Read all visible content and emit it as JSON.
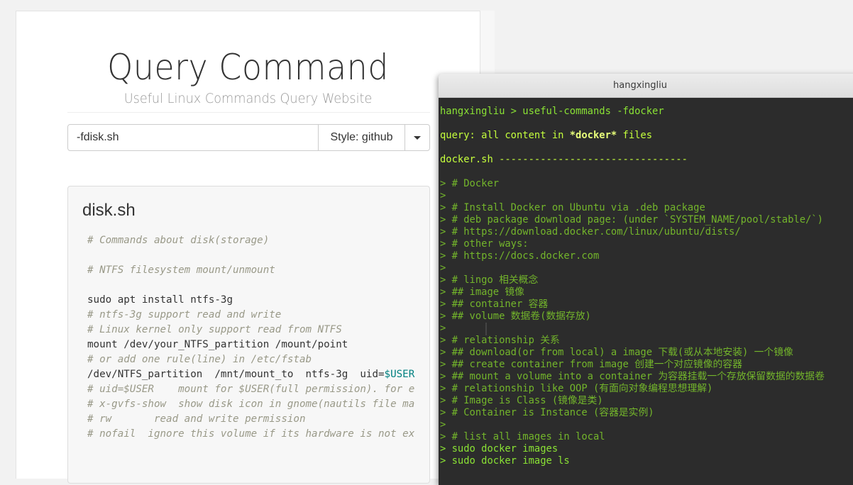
{
  "site": {
    "title": "Query Command",
    "subtitle": "Useful Linux Commands Query Website"
  },
  "search": {
    "value": "-fdisk.sh",
    "style_label": "Style: github"
  },
  "result": {
    "title": "disk.sh",
    "lines": [
      {
        "t": "# Commands about disk(storage)",
        "k": "comment"
      },
      {
        "t": "",
        "k": "code"
      },
      {
        "t": "# NTFS filesystem mount/unmount",
        "k": "comment"
      },
      {
        "t": "",
        "k": "code"
      },
      {
        "t": "sudo apt install ntfs-3g",
        "k": "code"
      },
      {
        "t": "# ntfs-3g support read and write",
        "k": "comment"
      },
      {
        "t": "# Linux kernel only support read from NTFS",
        "k": "comment"
      },
      {
        "t": "mount /dev/your_NTFS_partition /mount/point",
        "k": "code"
      },
      {
        "t": "# or add one rule(line) in /etc/fstab",
        "k": "comment"
      },
      {
        "t": "/dev/NTFS_partition  /mnt/mount_to  ntfs-3g  uid=",
        "k": "code",
        "var": "$USER"
      },
      {
        "t": "# uid=$USER    mount for $USER(full permission). for e",
        "k": "comment"
      },
      {
        "t": "# x-gvfs-show  show disk icon in gnome(nautils file ma",
        "k": "comment"
      },
      {
        "t": "# rw       read and write permission",
        "k": "comment"
      },
      {
        "t": "# nofail  ignore this volume if its hardware is not ex",
        "k": "comment"
      }
    ]
  },
  "terminal": {
    "title": "hangxingliu",
    "lines": [
      {
        "t": "hangxingliu > useful-commands -fdocker",
        "k": "prompt"
      },
      {
        "t": "",
        "k": "blank"
      },
      {
        "t": "query: all content in ",
        "k": "query",
        "bold": "*docker*",
        "rest": " files"
      },
      {
        "t": "",
        "k": "blank"
      },
      {
        "t": "docker.sh --------------------------------",
        "k": "header"
      },
      {
        "t": "",
        "k": "blank"
      },
      {
        "t": "> # Docker",
        "k": "comment"
      },
      {
        "t": ">",
        "k": "comment"
      },
      {
        "t": "> # Install Docker on Ubuntu via .deb package",
        "k": "comment"
      },
      {
        "t": "> # deb package download page: (under `SYSTEM_NAME/pool/stable/`)",
        "k": "comment"
      },
      {
        "t": "> # https://download.docker.com/linux/ubuntu/dists/",
        "k": "comment"
      },
      {
        "t": "> # other ways:",
        "k": "comment"
      },
      {
        "t": "> # https://docs.docker.com",
        "k": "comment"
      },
      {
        "t": ">",
        "k": "comment"
      },
      {
        "t": "> # lingo 相关概念",
        "k": "comment"
      },
      {
        "t": "> ## image 镜像",
        "k": "comment"
      },
      {
        "t": "> ## container 容器",
        "k": "comment"
      },
      {
        "t": "> ## volume 数据卷(数据存放)",
        "k": "comment"
      },
      {
        "t": ">",
        "k": "comment"
      },
      {
        "t": "> # relationship 关系",
        "k": "comment"
      },
      {
        "t": "> ## download(or from local) a image 下载(或从本地安装) 一个镜像",
        "k": "comment"
      },
      {
        "t": "> ## create container from image 创建一个对应镜像的容器",
        "k": "comment"
      },
      {
        "t": "> ## mount a volume into a container 为容器挂载一个存放保留数据的数据卷",
        "k": "comment"
      },
      {
        "t": "> # relationship like OOP (有面向对象编程思想理解)",
        "k": "comment"
      },
      {
        "t": "> # Image is Class (镜像是类)",
        "k": "comment"
      },
      {
        "t": "> # Container is Instance (容器是实例)",
        "k": "comment"
      },
      {
        "t": ">",
        "k": "comment"
      },
      {
        "t": "> # list all images in local",
        "k": "comment"
      },
      {
        "t": "> sudo docker images",
        "k": "command"
      },
      {
        "t": "> sudo docker image ls",
        "k": "command"
      }
    ]
  },
  "colors": {
    "terminal_bg": "#2c2c2c",
    "terminal_green": "#8ae234",
    "code_comment": "#999988",
    "code_variable": "#008080"
  }
}
